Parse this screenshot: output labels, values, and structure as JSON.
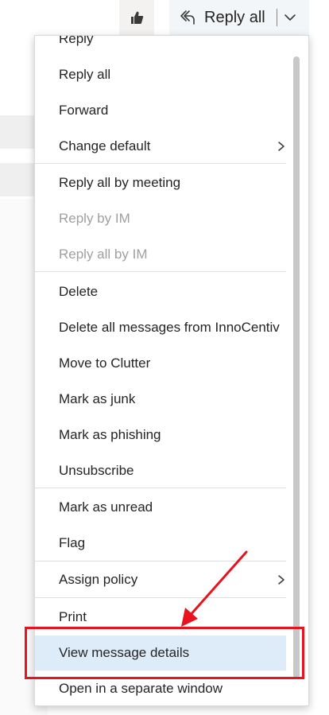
{
  "toolbar": {
    "like_icon": "thumbs-up-icon",
    "reply_icon": "reply-all-icon",
    "reply_all_label": "Reply all",
    "dropdown_icon": "chevron-down-icon"
  },
  "menu": {
    "items": [
      {
        "label": "Reply",
        "state": "normal"
      },
      {
        "label": "Reply all",
        "state": "normal"
      },
      {
        "label": "Forward",
        "state": "normal"
      },
      {
        "label": "Change default",
        "state": "normal",
        "submenu": true
      },
      {
        "label": "Reply all by meeting",
        "state": "normal"
      },
      {
        "label": "Reply by IM",
        "state": "disabled"
      },
      {
        "label": "Reply all by IM",
        "state": "disabled"
      },
      {
        "label": "Delete",
        "state": "normal"
      },
      {
        "label": "Delete all messages from InnoCentiv",
        "state": "normal"
      },
      {
        "label": "Move to Clutter",
        "state": "normal"
      },
      {
        "label": "Mark as junk",
        "state": "normal"
      },
      {
        "label": "Mark as phishing",
        "state": "normal"
      },
      {
        "label": "Unsubscribe",
        "state": "normal"
      },
      {
        "label": "Mark as unread",
        "state": "normal"
      },
      {
        "label": "Flag",
        "state": "normal"
      },
      {
        "label": "Assign policy",
        "state": "normal",
        "submenu": true
      },
      {
        "label": "Print",
        "state": "normal"
      },
      {
        "label": "View message details",
        "state": "selected"
      },
      {
        "label": "Open in a separate window",
        "state": "normal"
      }
    ]
  },
  "colors": {
    "selected_bg": "#deecf9",
    "disabled_text": "#a19f9d",
    "annotation": "#e8131e"
  }
}
